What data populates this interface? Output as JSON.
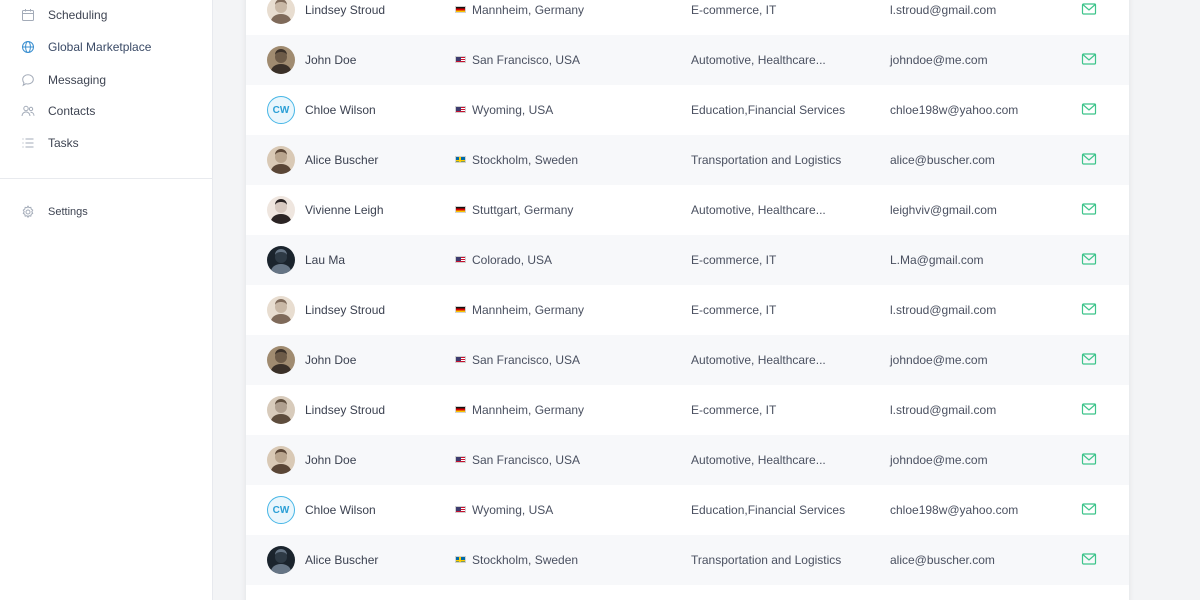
{
  "sidebar": {
    "items": [
      {
        "label": "Scheduling",
        "icon": "calendar-icon"
      },
      {
        "label": "Global Marketplace",
        "icon": "globe-icon"
      },
      {
        "label": "Messaging",
        "icon": "chat-bubble-icon"
      },
      {
        "label": "Contacts",
        "icon": "users-icon"
      },
      {
        "label": "Tasks",
        "icon": "list-icon"
      }
    ],
    "settings": {
      "label": "Settings",
      "icon": "gear-icon"
    }
  },
  "colors": {
    "accent_mail": "#3cc48a",
    "initials_blue": "#2a9fd6",
    "row_alt": "#f7f8fa",
    "icon_gray": "#9aa3b2"
  },
  "contacts": [
    {
      "name": "Lindsey Stroud",
      "avatar": "photo-avatar",
      "flag": "de",
      "location": "Mannheim, Germany",
      "industry": "E-commerce, IT",
      "email": "l.stroud@gmail.com"
    },
    {
      "name": "John Doe",
      "avatar": "photo-avatar",
      "flag": "us",
      "location": "San Francisco, USA",
      "industry": "Automotive, Healthcare...",
      "email": "johndoe@me.com"
    },
    {
      "name": "Chloe Wilson",
      "avatar": "initials-avatar",
      "initials": "CW",
      "flag": "us",
      "location": "Wyoming, USA",
      "industry": "Education,Financial Services",
      "email": "chloe198w@yahoo.com"
    },
    {
      "name": "Alice Buscher",
      "avatar": "photo-avatar",
      "flag": "se",
      "location": "Stockholm, Sweden",
      "industry": "Transportation and Logistics",
      "email": "alice@buscher.com"
    },
    {
      "name": "Vivienne Leigh",
      "avatar": "photo-avatar",
      "flag": "de",
      "location": "Stuttgart, Germany",
      "industry": "Automotive, Healthcare...",
      "email": "leighviv@gmail.com"
    },
    {
      "name": "Lau Ma",
      "avatar": "photo-avatar",
      "flag": "us",
      "location": "Colorado, USA",
      "industry": "E-commerce, IT",
      "email": "L.Ma@gmail.com"
    },
    {
      "name": "Lindsey Stroud",
      "avatar": "photo-avatar",
      "flag": "de",
      "location": "Mannheim, Germany",
      "industry": "E-commerce, IT",
      "email": "l.stroud@gmail.com"
    },
    {
      "name": "John Doe",
      "avatar": "photo-avatar",
      "flag": "us",
      "location": "San Francisco, USA",
      "industry": "Automotive, Healthcare...",
      "email": "johndoe@me.com"
    },
    {
      "name": "Lindsey Stroud",
      "avatar": "photo-avatar",
      "flag": "de",
      "location": "Mannheim, Germany",
      "industry": "E-commerce, IT",
      "email": "l.stroud@gmail.com"
    },
    {
      "name": "John Doe",
      "avatar": "photo-avatar",
      "flag": "us",
      "location": "San Francisco, USA",
      "industry": "Automotive, Healthcare...",
      "email": "johndoe@me.com"
    },
    {
      "name": "Chloe Wilson",
      "avatar": "initials-avatar",
      "initials": "CW",
      "flag": "us",
      "location": "Wyoming, USA",
      "industry": "Education,Financial Services",
      "email": "chloe198w@yahoo.com"
    },
    {
      "name": "Alice Buscher",
      "avatar": "photo-avatar",
      "flag": "se",
      "location": "Stockholm, Sweden",
      "industry": "Transportation and Logistics",
      "email": "alice@buscher.com"
    }
  ]
}
